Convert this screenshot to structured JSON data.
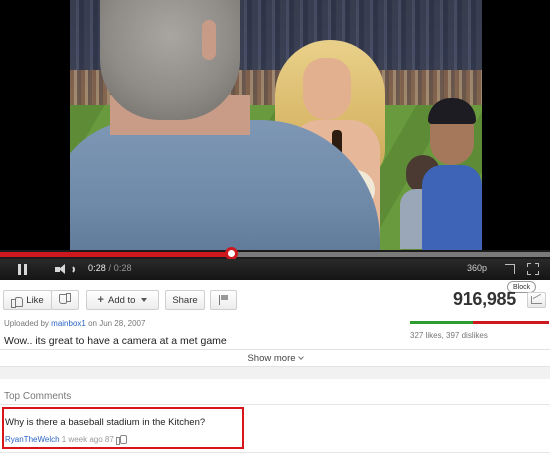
{
  "player": {
    "current_time": "0:28",
    "separator": " / ",
    "total_time": "0:28",
    "progress_fraction": 0.42,
    "quality": "360p"
  },
  "actions": {
    "like_label": "Like",
    "add_to_label": "Add to",
    "share_label": "Share"
  },
  "video_stats": {
    "view_count": "916,985",
    "tooltip": "Block",
    "likes_dislikes": "327 likes, 397 dislikes",
    "like_fraction": 0.45
  },
  "description": {
    "uploaded_prefix": "Uploaded by ",
    "uploader": "mainbox1",
    "uploaded_suffix": " on Jun 28, 2007",
    "text": "Wow.. its great to have a camera at a met game",
    "show_more_label": "Show more"
  },
  "comments": {
    "heading": "Top Comments",
    "items": [
      {
        "text": "Why is there a baseball stadium in the Kitchen?",
        "author": "RyanTheWelch",
        "age": " 1 week ago ",
        "score": "87"
      }
    ]
  },
  "colors": {
    "accent_red": "#cc181e",
    "link_blue": "#2b64c2",
    "like_green": "#2f9c2f",
    "highlight_border": "#d7151b"
  }
}
